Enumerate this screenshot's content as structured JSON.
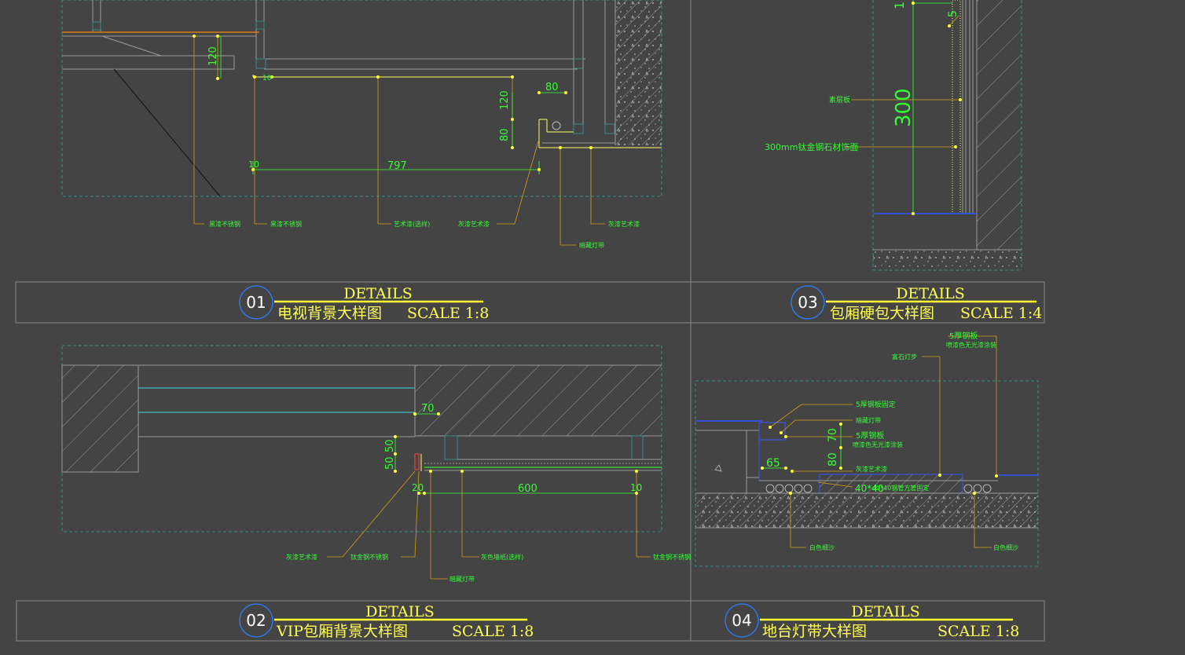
{
  "colors": {
    "background": "#444444",
    "frame": "#8a8a8a",
    "dimension_text": "#33ff33",
    "leader": "#d4a017",
    "title_text": "#ffff55",
    "bubble": "#2a7fff",
    "wall_line": "#9a9a9a",
    "cyan_line": "#33dddd",
    "blue_line": "#3355ff"
  },
  "panels": {
    "p01": {
      "number": "01",
      "heading": "DETAILS",
      "name": "电视背景大样图",
      "scale": "SCALE 1:8",
      "dims": [
        "120",
        "80",
        "120",
        "80",
        "10",
        "797",
        "10"
      ],
      "notes": [
        "黑漆不锈钢",
        "黑漆不锈钢",
        "艺术漆(选样)",
        "灰漆艺术漆",
        "灰漆艺术漆",
        "暗藏灯带"
      ]
    },
    "p02": {
      "number": "02",
      "heading": "DETAILS",
      "name": "VIP包厢背景大样图",
      "scale": "SCALE 1:8",
      "dims": [
        "70",
        "50",
        "50",
        "20",
        "600",
        "10"
      ],
      "notes": [
        "灰漆艺术漆",
        "钛金钢不锈钢",
        "灰色墙纸(选样)",
        "钛金钢不锈钢",
        "暗藏灯带"
      ]
    },
    "p03": {
      "number": "03",
      "heading": "DETAILS",
      "name": "包厢硬包大样图",
      "scale": "SCALE 1:4",
      "dims": [
        "300",
        "1",
        "5"
      ],
      "notes": [
        "素层板",
        "300mm钛金钢石材饰面"
      ]
    },
    "p04": {
      "number": "04",
      "heading": "DETAILS",
      "name": "地台灯带大样图",
      "scale": "SCALE 1:8",
      "dims": [
        "70",
        "80",
        "65",
        "40*40"
      ],
      "notes": [
        "5厚钢板",
        "喷漆色无光漆涂装",
        "富石灯步",
        "5厚钢板固定",
        "暗藏灯带",
        "5厚钢板",
        "喷漆色无光漆涂装",
        "灰漆艺术漆",
        "40*40钢管方管固定",
        "白色细沙",
        "白色细沙"
      ]
    }
  }
}
